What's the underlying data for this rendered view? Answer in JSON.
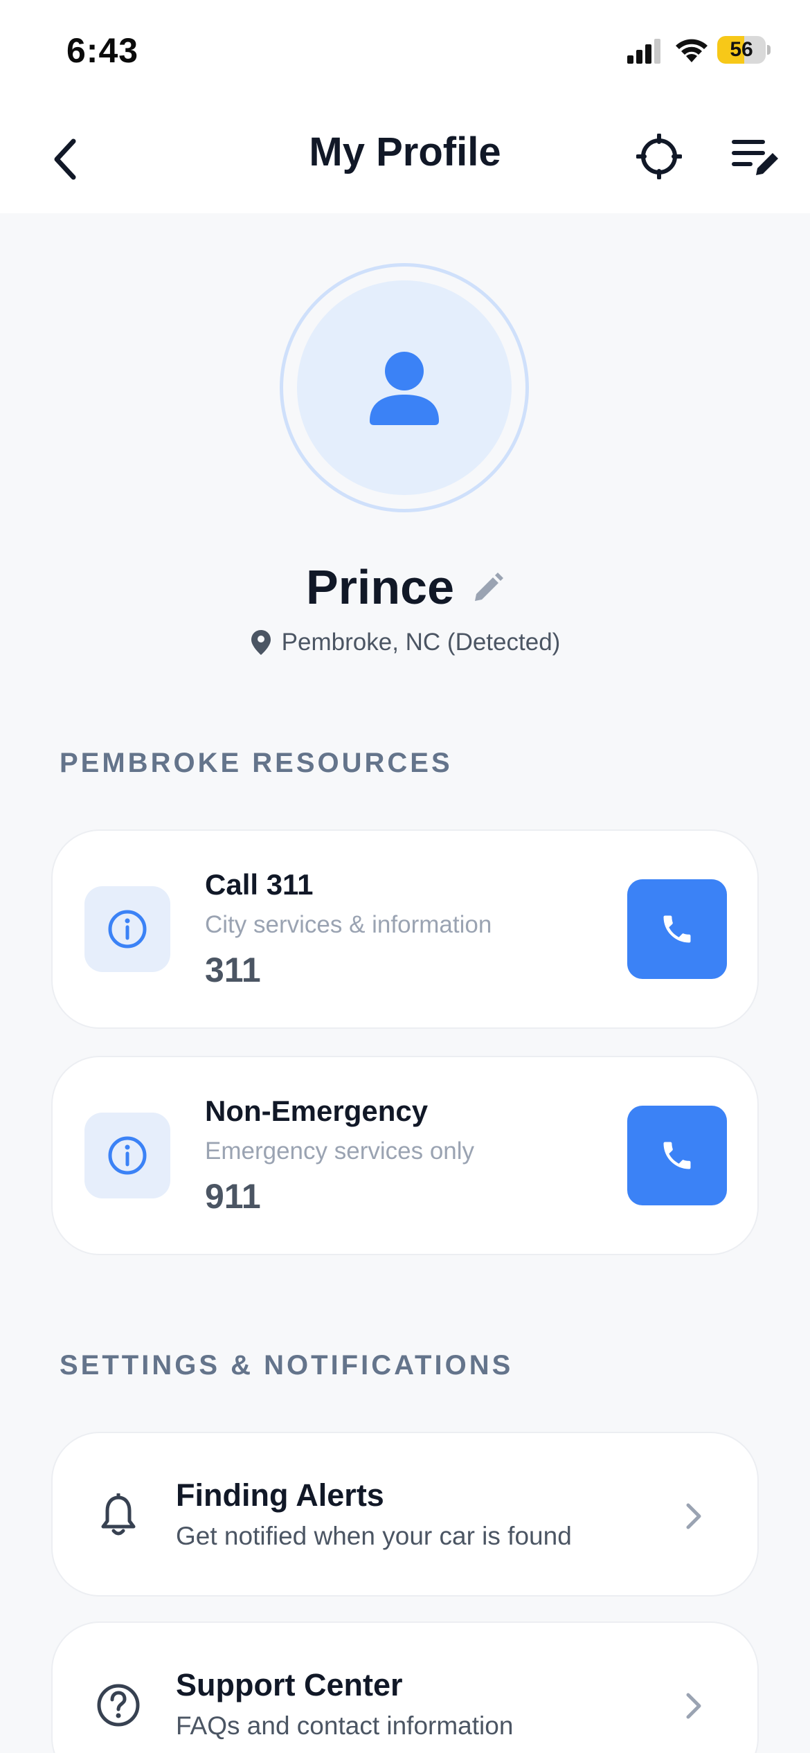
{
  "status_bar": {
    "time": "6:43",
    "battery_level": "56",
    "battery_fraction": 0.56
  },
  "nav": {
    "title": "My Profile",
    "back_icon": "chevron-left-icon",
    "locate_icon": "crosshair-icon",
    "edit_list_icon": "list-edit-icon"
  },
  "profile": {
    "name": "Prince",
    "location": "Pembroke, NC (Detected)",
    "avatar_icon": "person-icon"
  },
  "resources": {
    "section_title": "PEMBROKE RESOURCES",
    "items": [
      {
        "title": "Call 311",
        "subtitle": "City services & information",
        "number": "311"
      },
      {
        "title": "Non-Emergency",
        "subtitle": "Emergency services only",
        "number": "911"
      }
    ]
  },
  "settings": {
    "section_title": "SETTINGS & NOTIFICATIONS",
    "items": [
      {
        "title": "Finding Alerts",
        "subtitle": "Get notified when your car is found",
        "icon": "bell-icon"
      },
      {
        "title": "Support Center",
        "subtitle": "FAQs and contact information",
        "icon": "question-circle-icon"
      }
    ]
  },
  "colors": {
    "accent": "#3b82f6",
    "accent_light": "#e4eefc",
    "background": "#f7f8fa",
    "battery_fill": "#f7c818"
  }
}
